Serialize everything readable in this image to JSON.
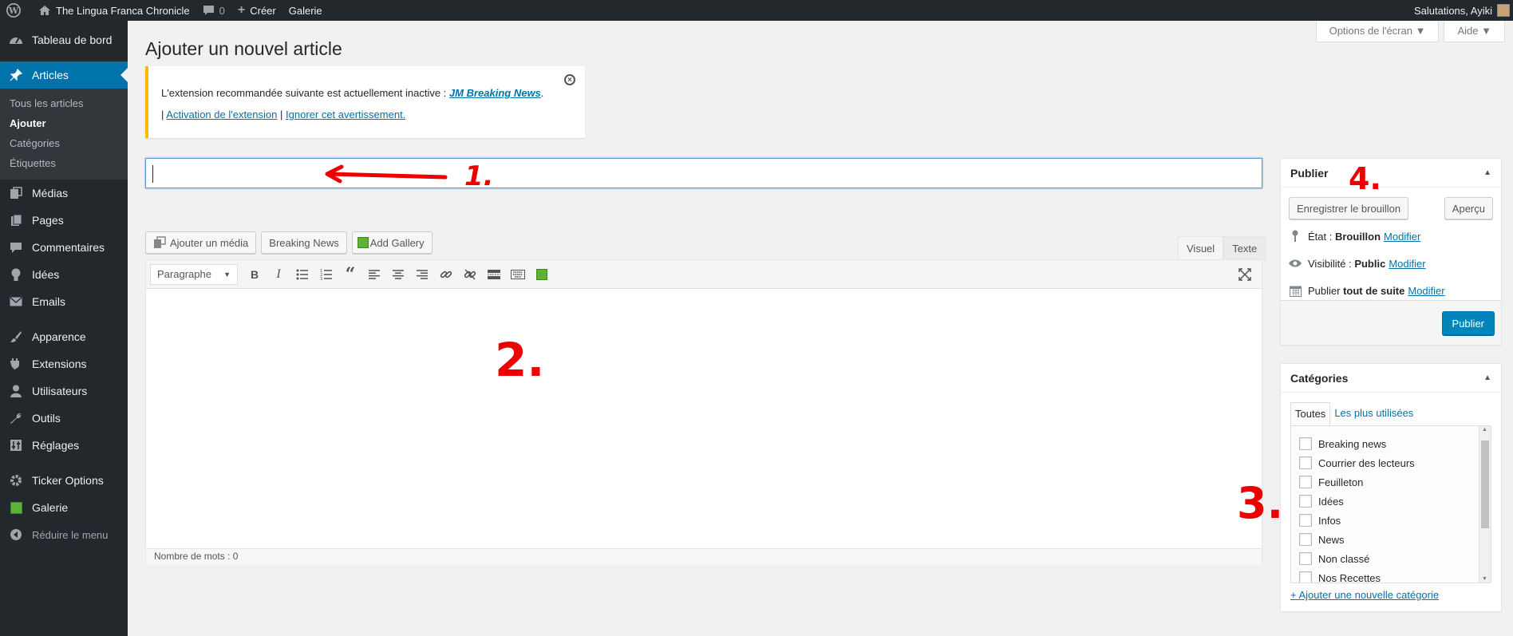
{
  "adminbar": {
    "site_name": "The Lingua Franca Chronicle",
    "comments_count": "0",
    "new_label": "Créer",
    "gallery_label": "Galerie",
    "greeting": "Salutations, Ayiki"
  },
  "sidebar": {
    "dashboard": "Tableau de bord",
    "articles": "Articles",
    "submenu": [
      "Tous les articles",
      "Ajouter",
      "Catégories",
      "Étiquettes"
    ],
    "items": [
      "Médias",
      "Pages",
      "Commentaires",
      "Idées",
      "Emails"
    ],
    "items2": [
      "Apparence",
      "Extensions",
      "Utilisateurs",
      "Outils",
      "Réglages"
    ],
    "items3": [
      "Ticker Options",
      "Galerie"
    ],
    "collapse": "Réduire le menu"
  },
  "screen_meta": {
    "options": "Options de l'écran",
    "help": "Aide"
  },
  "page": {
    "title": "Ajouter un nouvel article"
  },
  "notice": {
    "text": "L'extension recommandée suivante est actuellement inactive : ",
    "plugin": "JM Breaking News",
    "sep": "|",
    "activate": "Activation de l'extension",
    "ignore": "Ignorer cet avertissement."
  },
  "media_buttons": {
    "add_media": "Ajouter un média",
    "breaking_news": "Breaking News",
    "add_gallery": "Add Gallery"
  },
  "editor": {
    "tab_visual": "Visuel",
    "tab_text": "Texte",
    "format": "Paragraphe",
    "word_count": "Nombre de mots : 0"
  },
  "publish": {
    "title": "Publier",
    "save_draft": "Enregistrer le brouillon",
    "preview": "Aperçu",
    "status_label": "État :",
    "status_value": "Brouillon",
    "visibility_label": "Visibilité :",
    "visibility_value": "Public",
    "schedule_label": "Publier",
    "schedule_value": "tout de suite",
    "edit": "Modifier",
    "publish_button": "Publier"
  },
  "categories": {
    "title": "Catégories",
    "tab_all": "Toutes",
    "tab_popular": "Les plus utilisées",
    "items": [
      "Breaking news",
      "Courrier des lecteurs",
      "Feuilleton",
      "Idées",
      "Infos",
      "News",
      "Non classé",
      "Nos Recettes"
    ],
    "add_new": "+ Ajouter une nouvelle catégorie"
  },
  "annotations": [
    "1.",
    "2.",
    "3.",
    "4."
  ],
  "colors": {
    "accent": "#0073aa",
    "sidebar_bg": "#23282d",
    "notice_border": "#ffb900",
    "annotation": "#e00000"
  }
}
